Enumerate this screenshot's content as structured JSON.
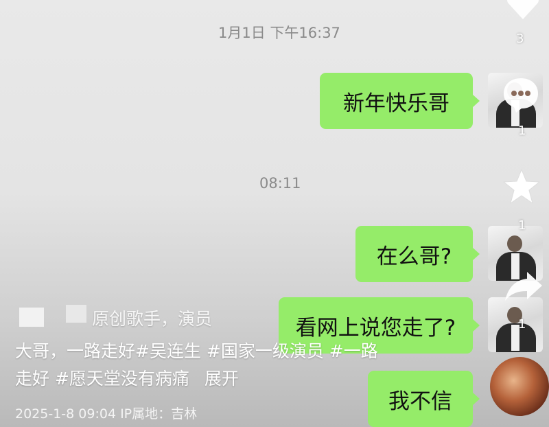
{
  "chat": {
    "timestamps": [
      "1月1日 下午16:37",
      "08:11"
    ],
    "messages": [
      "新年快乐哥",
      "在么哥?",
      "看网上说您走了?",
      "我不信"
    ]
  },
  "side": {
    "counts": [
      "3",
      "1",
      "1",
      "1"
    ]
  },
  "overlay": {
    "header_partial": "原创歌手，演员",
    "caption_line1": "大哥，一路走好#吴连生 #国家一级演员 #一路",
    "caption_line2": "走好 #愿天堂没有病痛",
    "expand_label": "展开",
    "meta": "2025-1-8 09:04  IP属地：吉林"
  }
}
